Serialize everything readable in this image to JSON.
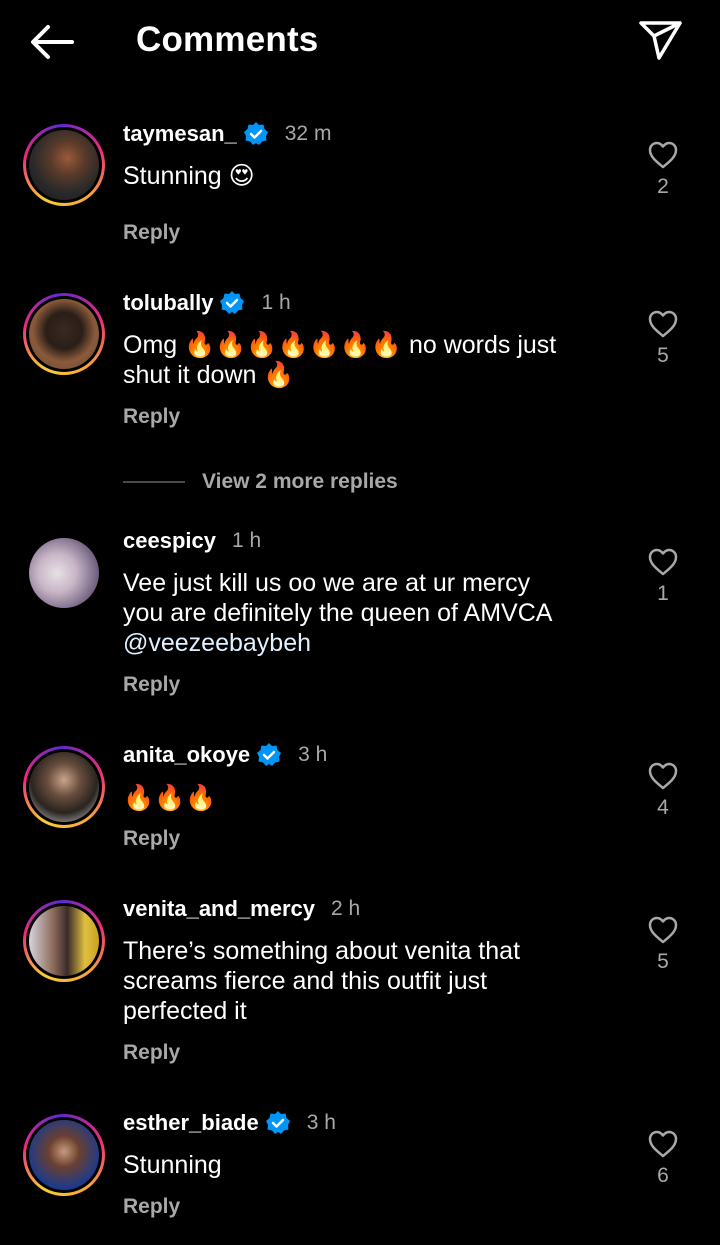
{
  "header": {
    "title": "Comments",
    "back_icon": "arrow-left-icon",
    "share_icon": "paper-plane-icon"
  },
  "colors": {
    "background": "#000000",
    "secondary_text": "#a8a8a8",
    "verified_badge": "#0095f6",
    "ring_gradient": [
      "#f9ce34",
      "#ee2a7b",
      "#6228d7"
    ]
  },
  "comments": [
    {
      "username": "taymesan_",
      "verified": true,
      "time": "32 m",
      "text": "Stunning 😍",
      "reply_label": "Reply",
      "likes": "2",
      "story_ring": true
    },
    {
      "username": "tolubally",
      "verified": true,
      "time": "1 h",
      "text_line1": "Omg 🔥🔥🔥🔥🔥🔥🔥 no words just",
      "text_line2": "shut it down 🔥",
      "reply_label": "Reply",
      "likes": "5",
      "story_ring": true,
      "view_more_replies": "View 2 more replies"
    },
    {
      "username": "ceespicy",
      "verified": false,
      "time": "1 h",
      "text_line1": "Vee just kill us oo we are at ur mercy",
      "text_line2": "you are definitely the queen of AMVCA",
      "mention": "@veezeebaybeh",
      "reply_label": "Reply",
      "likes": "1",
      "story_ring": false
    },
    {
      "username": "anita_okoye",
      "verified": true,
      "time": "3 h",
      "text": "🔥🔥🔥",
      "reply_label": "Reply",
      "likes": "4",
      "story_ring": true
    },
    {
      "username": "venita_and_mercy",
      "verified": false,
      "time": "2 h",
      "text_line1": "There’s something about venita that",
      "text_line2": "screams fierce and this outfit just",
      "text_line3": "perfected it",
      "reply_label": "Reply",
      "likes": "5",
      "story_ring": true
    },
    {
      "username": "esther_biade",
      "verified": true,
      "time": "3 h",
      "text": "Stunning",
      "reply_label": "Reply",
      "likes": "6",
      "story_ring": true
    }
  ]
}
